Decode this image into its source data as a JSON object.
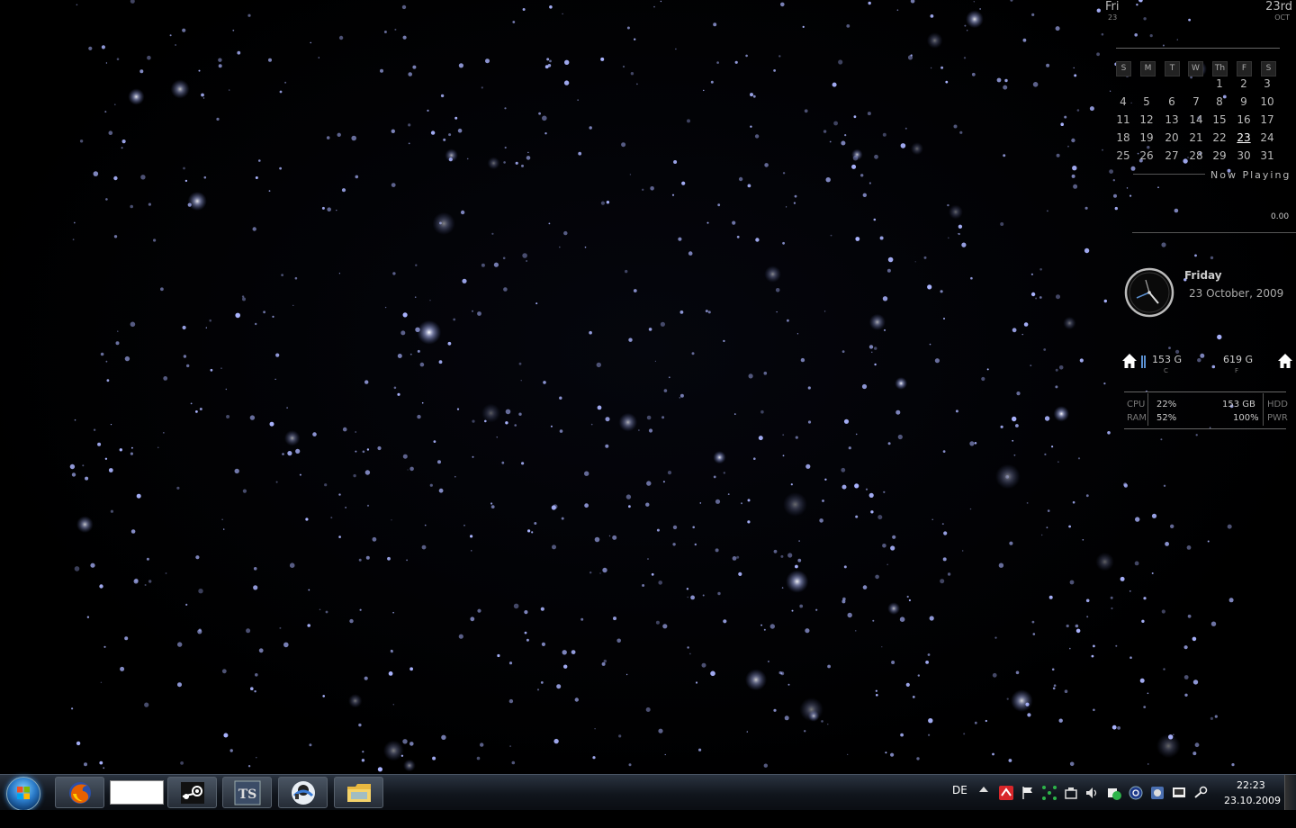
{
  "date_strip": {
    "day": "Fri",
    "day_num": "23",
    "ordinal": "23rd",
    "month": "OCT"
  },
  "calendar": {
    "headers": [
      "S",
      "M",
      "T",
      "W",
      "Th",
      "F",
      "S"
    ],
    "weeks": [
      [
        "",
        "",
        "",
        "",
        "1",
        "2",
        "3"
      ],
      [
        "4",
        "5",
        "6",
        "7",
        "8",
        "9",
        "10"
      ],
      [
        "11",
        "12",
        "13",
        "14",
        "15",
        "16",
        "17"
      ],
      [
        "18",
        "19",
        "20",
        "21",
        "22",
        "23",
        "24"
      ],
      [
        "25",
        "26",
        "27",
        "28",
        "29",
        "30",
        "31"
      ]
    ],
    "today": "23"
  },
  "now_playing": {
    "label": "Now Playing",
    "value": "0.00"
  },
  "clock_widget": {
    "day": "Friday",
    "date": "23 October, 2009"
  },
  "drives": [
    {
      "size": "153 G",
      "letter": "C"
    },
    {
      "size": "619 G",
      "letter": "F"
    }
  ],
  "stats": {
    "cpu_label": "CPU",
    "cpu_value": "22%",
    "ram_label": "RAM",
    "ram_value": "52%",
    "hdd_value": "153 GB",
    "hdd_label": "HDD",
    "pwr_value": "100%",
    "pwr_label": "PWR"
  },
  "taskbar": {
    "apps": [
      "firefox-icon",
      "blank-window",
      "steam-icon",
      "teamspeak-icon",
      "ventrilo-icon",
      "explorer-folder-icon"
    ],
    "tray": {
      "language": "DE",
      "icons": [
        "antivirus-icon",
        "flag-icon",
        "network-icon",
        "usb-icon",
        "volume-icon",
        "security-icon",
        "wifi-icon",
        "app-icon",
        "display-icon",
        "steam-tray-icon"
      ]
    },
    "time": "22:23",
    "date": "23.10.2009"
  },
  "colors": {
    "accent": "#5a8fd0",
    "star": "#aab4ff"
  }
}
